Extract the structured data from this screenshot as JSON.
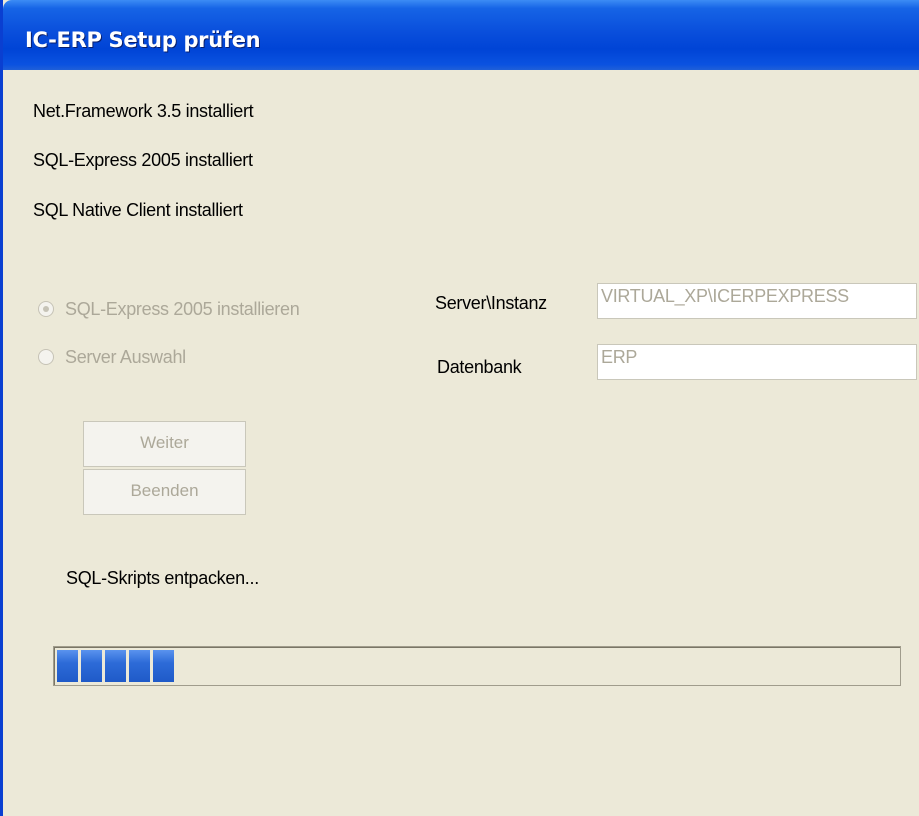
{
  "window": {
    "title": "IC-ERP Setup prüfen"
  },
  "status_lines": [
    "Net.Framework 3.5 installiert",
    "SQL-Express 2005 installiert",
    "SQL Native Client installiert"
  ],
  "options": {
    "install_express": {
      "label": "SQL-Express 2005 installieren",
      "selected": true,
      "enabled": false
    },
    "server_select": {
      "label": "Server Auswahl",
      "selected": false,
      "enabled": false
    }
  },
  "fields": {
    "server_instance": {
      "label": "Server\\Instanz",
      "value": "VIRTUAL_XP\\ICERPEXPRESS"
    },
    "database": {
      "label": "Datenbank",
      "value": "ERP"
    }
  },
  "buttons": {
    "next": "Weiter",
    "quit": "Beenden"
  },
  "progress": {
    "message": "SQL-Skripts entpacken...",
    "filled_segments": 5,
    "fraction": 0.17
  },
  "colors": {
    "titlebar": "#0a4fdc",
    "progress_fill": "#2f6fd6",
    "background": "#ece9d8",
    "disabled_text": "#aca899"
  }
}
